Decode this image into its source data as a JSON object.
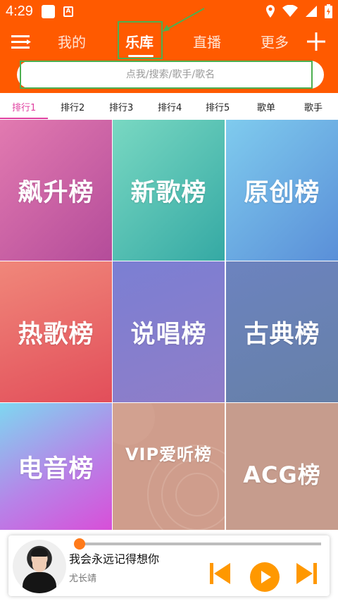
{
  "status": {
    "time": "4:29",
    "a_icon": "A"
  },
  "nav": {
    "tabs": [
      {
        "label": "我的"
      },
      {
        "label": "乐库"
      },
      {
        "label": "直播"
      },
      {
        "label": "更多"
      }
    ],
    "active_tab": "乐库"
  },
  "search": {
    "placeholder": "点我/搜索/歌手/歌名"
  },
  "subtabs": [
    "排行1",
    "排行2",
    "排行3",
    "排行4",
    "排行5",
    "歌单",
    "歌手"
  ],
  "charts": [
    {
      "label": "飙升榜"
    },
    {
      "label": "新歌榜"
    },
    {
      "label": "原创榜"
    },
    {
      "label": "热歌榜"
    },
    {
      "label": "说唱榜"
    },
    {
      "label": "古典榜"
    },
    {
      "label": "电音榜"
    },
    {
      "label": "VIP爱听榜"
    },
    {
      "label": "ACG榜"
    }
  ],
  "player": {
    "song_title": "我会永远记得想你",
    "artist": "尤长靖",
    "progress": 0.02
  },
  "colors": {
    "header": "#ff5a00",
    "accent": "#ff9800",
    "subtab_active": "#e040a0",
    "annotation": "#4caf50"
  },
  "icons": [
    "menu-icon",
    "plus-icon",
    "location-icon",
    "wifi-icon",
    "signal-icon",
    "battery-icon",
    "prev-icon",
    "play-icon",
    "next-icon"
  ]
}
